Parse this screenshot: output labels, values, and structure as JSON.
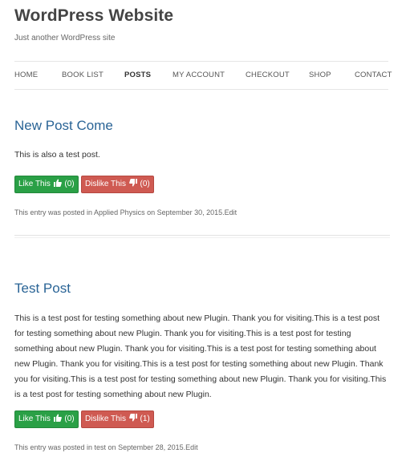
{
  "site": {
    "title": "WordPress Website",
    "description": "Just another WordPress site"
  },
  "nav": {
    "items": [
      {
        "label": "HOME"
      },
      {
        "label": "BOOK LIST"
      },
      {
        "label": "POSTS"
      },
      {
        "label": "MY ACCOUNT"
      },
      {
        "label": "CHECKOUT"
      },
      {
        "label": "SHOP"
      },
      {
        "label": "CONTACT"
      }
    ],
    "active": "POSTS"
  },
  "posts": [
    {
      "title": "New Post Come",
      "body": "This is also a test post.",
      "like_label": "Like This",
      "like_count": "(0)",
      "dislike_label": "Dislike This",
      "dislike_count": "(0)",
      "meta": "This entry was posted in Applied Physics on September 30, 2015.Edit"
    },
    {
      "title": "Test Post",
      "body": "This is a test post for testing something about new Plugin. Thank you for visiting.This is a test post for testing something about new Plugin. Thank you for visiting.This is a test post for testing something about new Plugin. Thank you for visiting.This is a test post for testing something about new Plugin. Thank you for visiting.This is a test post for testing something about new Plugin. Thank you for visiting.This is a test post for testing something about new Plugin. Thank you for visiting.This is a test post for testing something about new Plugin.",
      "like_label": "Like This",
      "like_count": "(0)",
      "dislike_label": "Dislike This",
      "dislike_count": "(1)",
      "meta": "This entry was posted in test on September 28, 2015.Edit"
    }
  ],
  "icons": {
    "like": "thumbs-up-icon",
    "dislike": "thumbs-down-icon"
  },
  "colors": {
    "link": "#2a6496",
    "like_button": "#2aa046",
    "dislike_button": "#cf5a52"
  }
}
